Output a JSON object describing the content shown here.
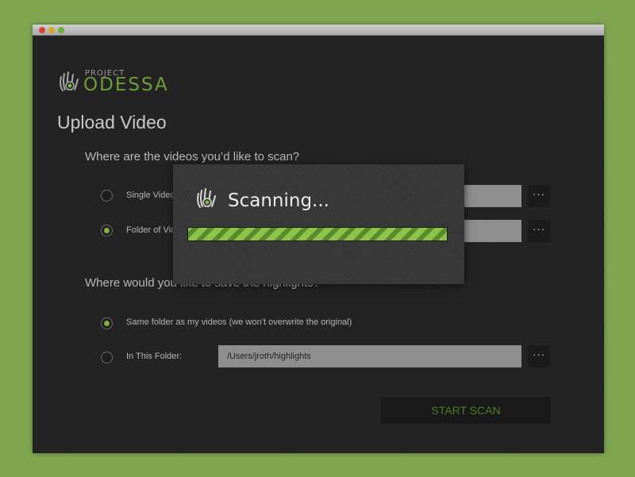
{
  "logo": {
    "small_text": "PROJECT",
    "big_text": "ODESSA"
  },
  "page_title": "Upload Video",
  "source_section": {
    "question": "Where are the videos you’d like to scan?",
    "options": [
      {
        "label": "Single Video:",
        "selected": false,
        "value": ""
      },
      {
        "label": "Folder of Videos:",
        "selected": true,
        "value": ""
      }
    ]
  },
  "save_section": {
    "question": "Where would you like to save the highlights?",
    "options": [
      {
        "label": "Same folder as my videos (we won’t overwrite the original)",
        "selected": true
      },
      {
        "label": "In This Folder:",
        "selected": false,
        "value": "/Users/jroth/highlights"
      }
    ]
  },
  "browse_label": "···",
  "start_button": "START SCAN",
  "modal": {
    "status": "Scanning...",
    "progress": 1.0
  },
  "colors": {
    "accent": "#7fb341",
    "background": "#7fa551"
  },
  "icons": {
    "logo": "hand-eye-icon",
    "modal": "hand-eye-icon"
  }
}
